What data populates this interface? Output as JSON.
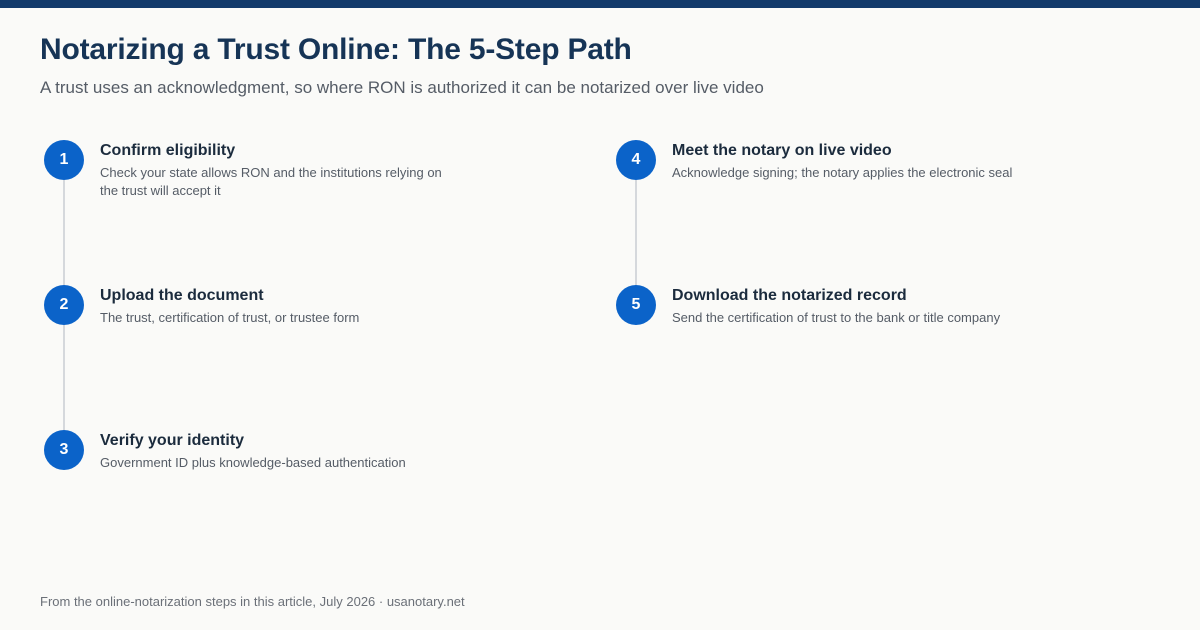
{
  "header": {
    "title": "Notarizing a Trust Online: The 5-Step Path",
    "subtitle": "A trust uses an acknowledgment, so where RON is authorized it can be notarized over live video"
  },
  "steps": [
    {
      "number": "1",
      "title": "Confirm eligibility",
      "description": "Check your state allows RON and the institutions relying on the trust will accept it"
    },
    {
      "number": "2",
      "title": "Upload the document",
      "description": "The trust, certification of trust, or trustee form"
    },
    {
      "number": "3",
      "title": "Verify your identity",
      "description": "Government ID plus knowledge-based authentication"
    },
    {
      "number": "4",
      "title": "Meet the notary on live video",
      "description": "Acknowledge signing; the notary applies the electronic seal"
    },
    {
      "number": "5",
      "title": "Download the notarized record",
      "description": "Send the certification of trust to the bank or title company"
    }
  ],
  "footer": {
    "source": "From the online-notarization steps in this article, July 2026 · usanotary.net"
  },
  "colors": {
    "top_bar": "#123a6b",
    "step_circle": "#0b63c9",
    "connector": "#d5d8dc",
    "title": "#163456"
  }
}
